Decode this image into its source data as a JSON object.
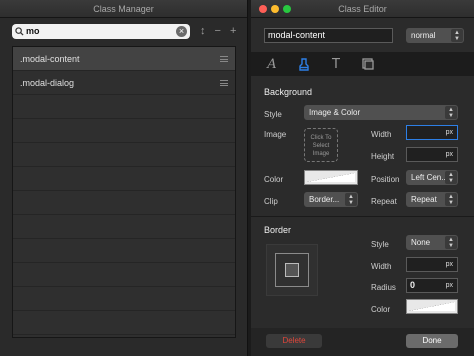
{
  "class_manager": {
    "title": "Class Manager",
    "search": {
      "value": "mo"
    },
    "tools": {
      "sort": "↕",
      "remove": "−",
      "add": "+"
    },
    "items": [
      {
        "label": ".modal-content"
      },
      {
        "label": ".modal-dialog"
      }
    ]
  },
  "class_editor": {
    "title": "Class Editor",
    "class_name": "modal-content",
    "state": "normal",
    "tabs": [
      "typography",
      "paint",
      "text",
      "layout"
    ],
    "background": {
      "heading": "Background",
      "style_label": "Style",
      "style_value": "Image & Color",
      "image_label": "Image",
      "image_placeholder": "Click To Select Image",
      "width_label": "Width",
      "width_unit": "px",
      "height_label": "Height",
      "height_unit": "px",
      "color_label": "Color",
      "position_label": "Position",
      "position_value": "Left Cen...",
      "clip_label": "Clip",
      "clip_value": "Border...",
      "repeat_label": "Repeat",
      "repeat_value": "Repeat"
    },
    "border": {
      "heading": "Border",
      "style_label": "Style",
      "style_value": "None",
      "width_label": "Width",
      "width_unit": "px",
      "radius_label": "Radius",
      "radius_value": "0",
      "radius_unit": "px",
      "color_label": "Color"
    },
    "delete_label": "Delete",
    "done_label": "Done"
  },
  "colors": {
    "close": "#ff5f57",
    "minimize": "#febc2e",
    "zoom": "#28c840",
    "accent_blue": "#2d7fe6",
    "delete_red": "#e0463a",
    "selected_row": "#434343"
  }
}
